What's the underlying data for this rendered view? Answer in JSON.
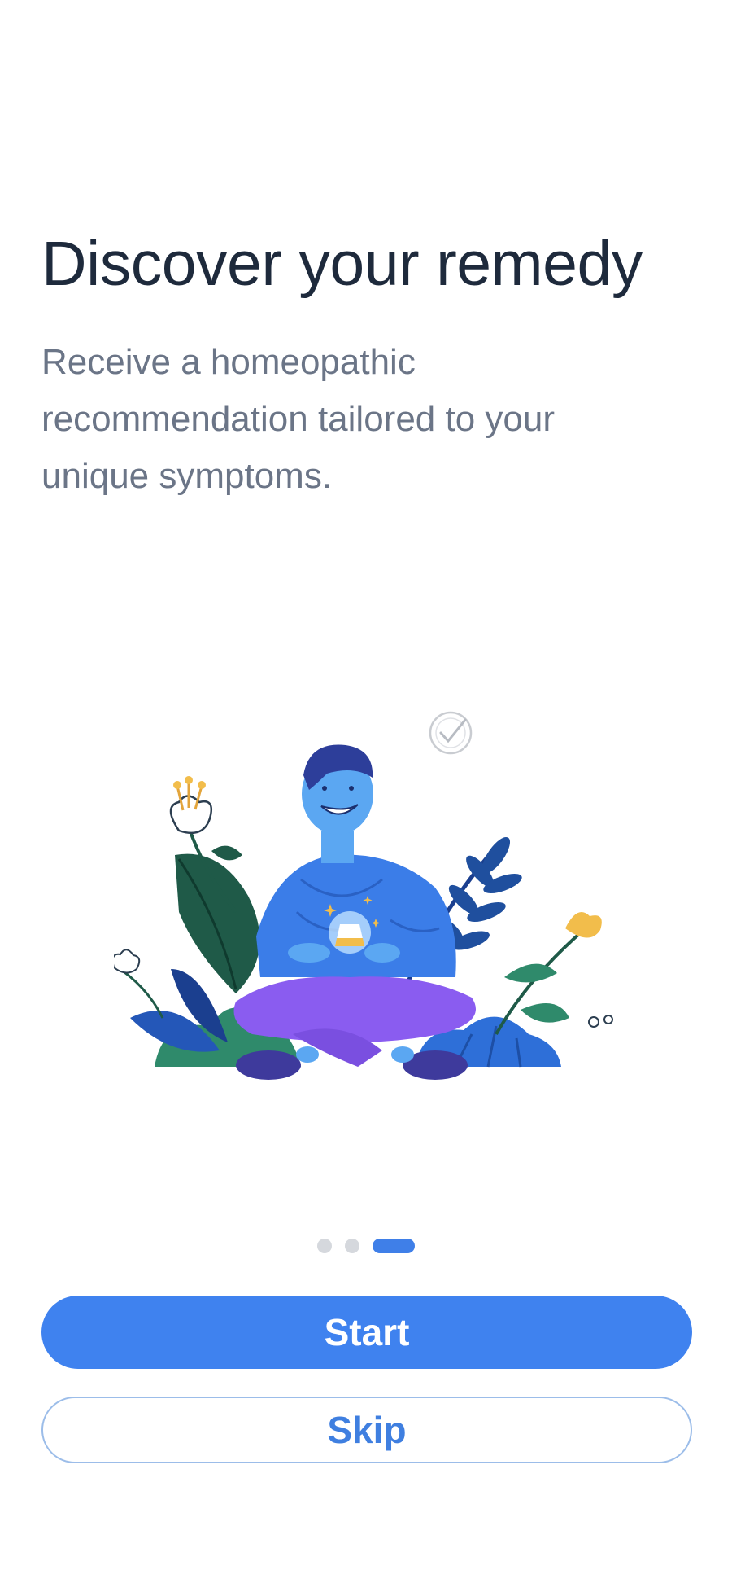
{
  "onboarding": {
    "title": "Discover your remedy",
    "subtitle": "Receive a homeopathic recommendation tailored to your unique symptoms.",
    "illustration": "person-meditating-with-remedy-bottle",
    "pager": {
      "total_pages": 3,
      "current_page": 3
    },
    "start_label": "Start",
    "skip_label": "Skip"
  },
  "colors": {
    "accent": "#3f82ef",
    "title_text": "#1e2a3c",
    "body_text": "#6b7587",
    "dot_inactive": "#d5d8dd"
  }
}
